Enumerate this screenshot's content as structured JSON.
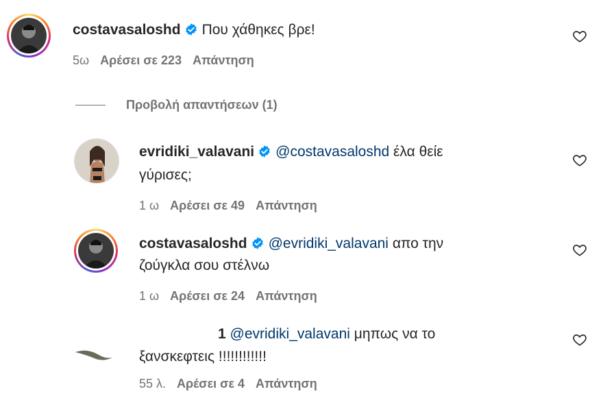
{
  "comments": [
    {
      "username": "costavasaloshd",
      "text": "Που χάθηκες βρε!",
      "time": "5ω",
      "likes": "Αρέσει σε 223",
      "reply": "Απάντηση"
    }
  ],
  "view_replies": "Προβολή απαντήσεων (1)",
  "replies": [
    {
      "username": "evridiki_valavani",
      "mention": "@costavasaloshd",
      "text_line1": "έλα θείε",
      "text_line2": "γύρισες;",
      "time": "1 ω",
      "likes": "Αρέσει σε 49",
      "reply": "Απάντηση"
    },
    {
      "username": "costavasaloshd",
      "mention": "@evridiki_valavani",
      "text_line1": "απο την",
      "text_line2": "ζούγκλα σου στέλνω",
      "time": "1 ω",
      "likes": "Αρέσει σε 24",
      "reply": "Απάντηση"
    },
    {
      "username": "1",
      "mention": "@evridiki_valavani",
      "text_line1": "μηπως να το",
      "text_line2": "ξανσκεφτεις !!!!!!!!!!!!",
      "time": "55 λ.",
      "likes": "Αρέσει σε 4",
      "reply": "Απάντηση"
    }
  ],
  "colors": {
    "verified": "#0095f6",
    "mention": "#00376b",
    "meta": "#737373"
  },
  "icons": [
    "verified-badge-icon",
    "heart-icon"
  ]
}
